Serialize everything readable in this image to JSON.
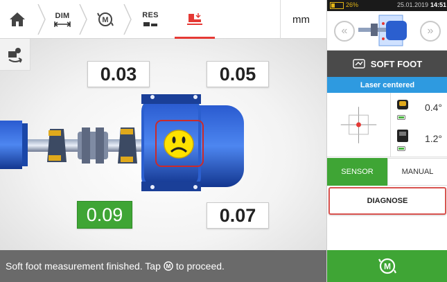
{
  "toolbar": {
    "home_icon": "home-icon",
    "dim_label": "DIM",
    "m_icon": "measure-m-icon",
    "res_label": "RES",
    "softfoot_icon": "soft-foot-icon",
    "unit_label": "mm",
    "active_color": "#e53935"
  },
  "side": {
    "icon": "machine-swap-icon"
  },
  "canvas": {
    "values": {
      "top_left": "0.03",
      "top_right": "0.05",
      "bottom_left": "0.09",
      "bottom_right": "0.07"
    },
    "highlighted_value": "0.09",
    "highlight_color": "#3fa535",
    "indicator_icon": "sad-face-icon"
  },
  "status": {
    "text_before": "Soft foot measurement finished. Tap",
    "text_after": "to proceed.",
    "icon": "measure-m-icon"
  },
  "right_panel": {
    "system": {
      "battery": "26%",
      "battery_level": 0.26,
      "date": "25.01.2019",
      "time": "14:51"
    },
    "preview": {
      "left_nav_icon": "chevron-left-icon",
      "right_nav_icon": "chevron-right-icon"
    },
    "header": {
      "icon": "soft-foot-panel-icon",
      "label": "SOFT FOOT"
    },
    "laser_status": "Laser centered",
    "readings": [
      {
        "icon": "sensor-icon",
        "value": "0.4°"
      },
      {
        "icon": "sensor-icon",
        "value": "1.2°"
      }
    ],
    "tabs": {
      "sensor": "SENSOR",
      "manual": "MANUAL",
      "active": "sensor"
    },
    "diagnose_label": "DIAGNOSE",
    "proceed_icon": "measure-m-icon",
    "accent_color": "#3fa535",
    "laser_color": "#2e9ae0"
  }
}
